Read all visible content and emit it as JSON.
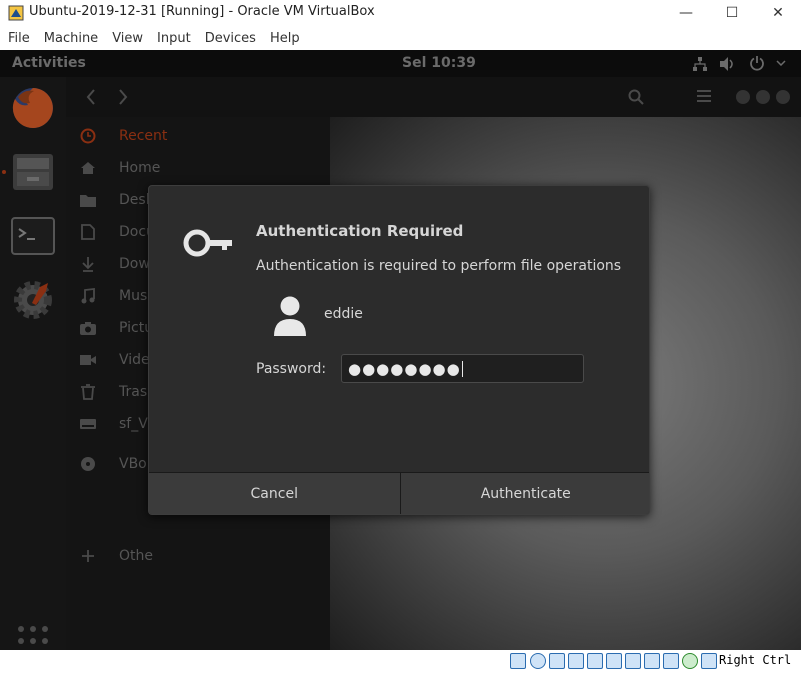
{
  "window": {
    "title": "Ubuntu-2019-12-31 [Running] - Oracle VM VirtualBox",
    "controls": {
      "minimize": "—",
      "maximize": "☐",
      "close": "✕"
    }
  },
  "menubar": [
    "File",
    "Machine",
    "View",
    "Input",
    "Devices",
    "Help"
  ],
  "ubuntu": {
    "activities": "Activities",
    "clock": "Sel 10:39"
  },
  "sidebar": {
    "items": [
      {
        "label": "Recent",
        "icon": "clock-icon",
        "active": true
      },
      {
        "label": "Home",
        "icon": "home-icon"
      },
      {
        "label": "Desk",
        "icon": "folder-icon"
      },
      {
        "label": "Docu",
        "icon": "document-icon"
      },
      {
        "label": "Dow",
        "icon": "download-icon"
      },
      {
        "label": "Musi",
        "icon": "music-icon"
      },
      {
        "label": "Pictu",
        "icon": "camera-icon"
      },
      {
        "label": "Vide",
        "icon": "video-icon"
      },
      {
        "label": "Tras",
        "icon": "trash-icon"
      },
      {
        "label": "sf_V",
        "icon": "drive-icon"
      },
      {
        "label": "VBo",
        "icon": "disc-icon"
      },
      {
        "label": "Othe",
        "icon": "plus-icon"
      }
    ]
  },
  "dialog": {
    "title": "Authentication Required",
    "message": "Authentication is required to perform file operations",
    "username": "eddie",
    "password_label": "Password:",
    "password_value": "●●●●●●●●",
    "cancel_label": "Cancel",
    "authenticate_label": "Authenticate"
  },
  "statusbar": {
    "host_key": "Right Ctrl"
  },
  "colors": {
    "accent": "#e95420",
    "dialog_bg": "#2c2c2c",
    "button_bg": "#3b3b3b"
  }
}
